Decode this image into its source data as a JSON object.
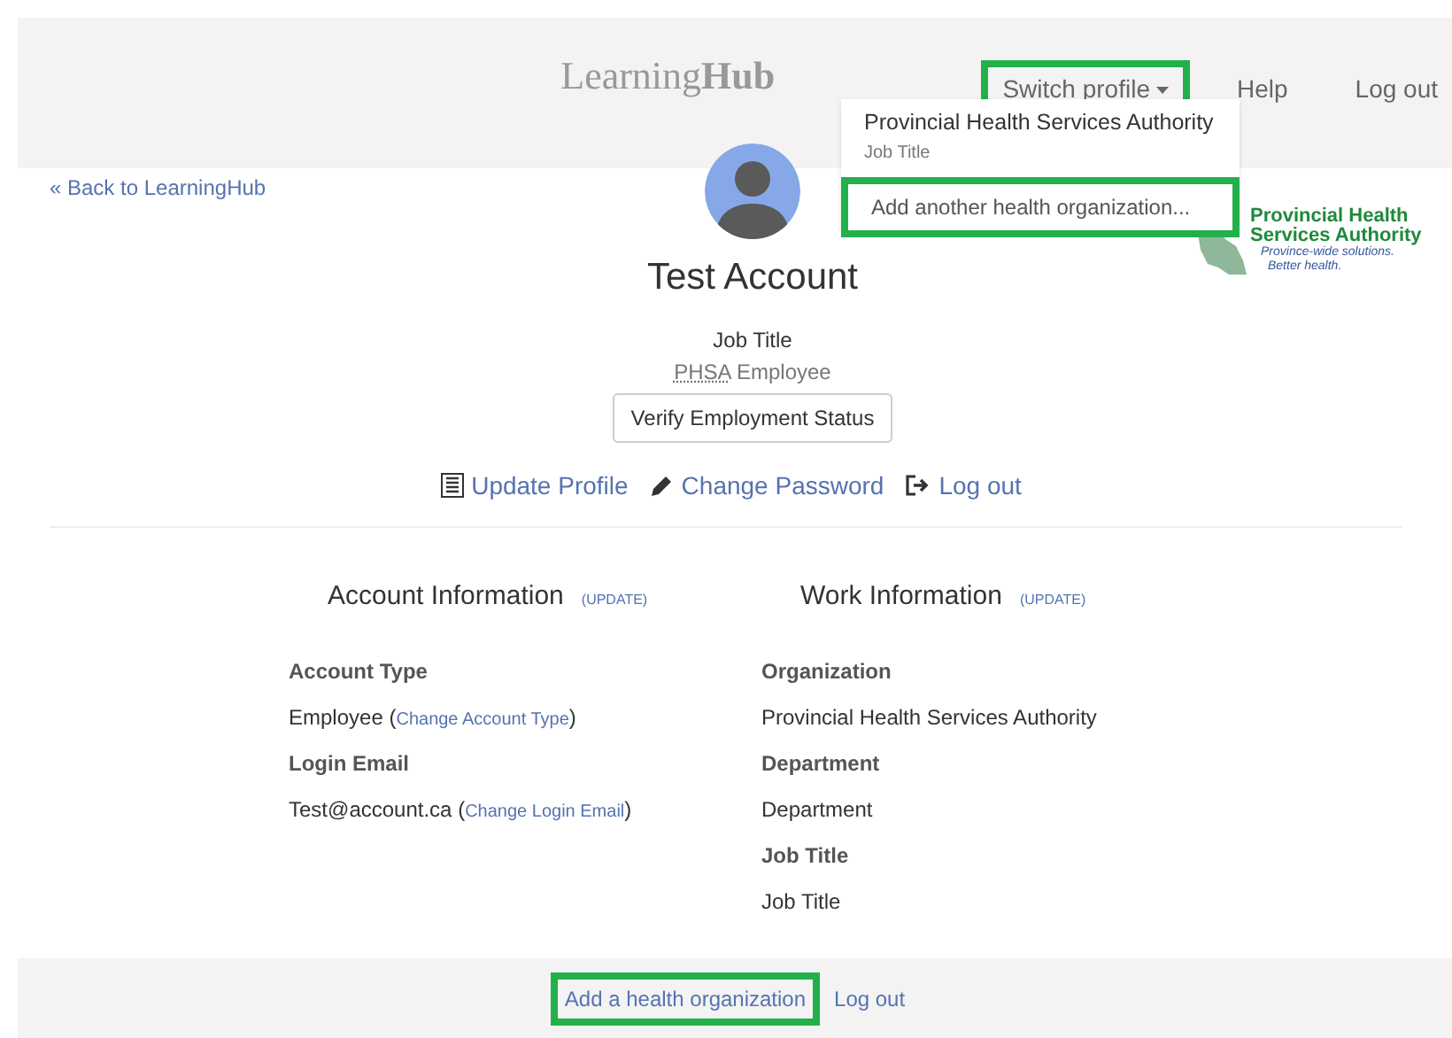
{
  "header": {
    "brand_light": "Learning",
    "brand_bold": "Hub",
    "nav": [
      {
        "label": "Switch profile",
        "kind": "dropdown",
        "highlighted": true
      },
      {
        "label": "Help",
        "kind": "link",
        "highlighted": false
      },
      {
        "label": "Log out",
        "kind": "link",
        "highlighted": false
      }
    ]
  },
  "dropdown": {
    "items": [
      {
        "title": "Provincial Health Services Authority",
        "subtitle": "Job Title",
        "highlighted": false
      },
      {
        "title": "Add another health organization...",
        "highlighted": true
      }
    ]
  },
  "back_link": "« Back to LearningHub",
  "logo": {
    "line1": "Provincial Health",
    "line2": "Services Authority",
    "tagline1": "Province-wide solutions.",
    "tagline2": "Better health."
  },
  "profile": {
    "name": "Test Account",
    "job_title": "Job Title",
    "employer_abbr": "PHSA",
    "employer_rest": "Employee",
    "verify_button": "Verify Employment Status"
  },
  "actions": [
    {
      "label": "Update Profile",
      "kind": "list"
    },
    {
      "label": "Change Password",
      "kind": "pencil"
    },
    {
      "label": "Log out",
      "kind": "logout"
    }
  ],
  "sections": [
    {
      "title": "Account Information",
      "update": "(UPDATE)",
      "fields": [
        {
          "label": "Account Type",
          "value": "Employee",
          "paren_open": "(",
          "link": "Change Account Type",
          "paren_close": ")"
        },
        {
          "label": "Login Email",
          "value": "Test@account.ca",
          "paren_open": "(",
          "link": "Change Login Email",
          "paren_close": ")"
        }
      ]
    },
    {
      "title": "Work Information",
      "update": "(UPDATE)",
      "fields": [
        {
          "label": "Organization",
          "value": "Provincial Health Services Authority"
        },
        {
          "label": "Department",
          "value": "Department"
        },
        {
          "label": "Job Title",
          "value": "Job Title"
        }
      ]
    }
  ],
  "footer": {
    "links": [
      {
        "label": "Add a health organization",
        "highlighted": true
      },
      {
        "label": "Log out",
        "highlighted": false
      }
    ]
  }
}
